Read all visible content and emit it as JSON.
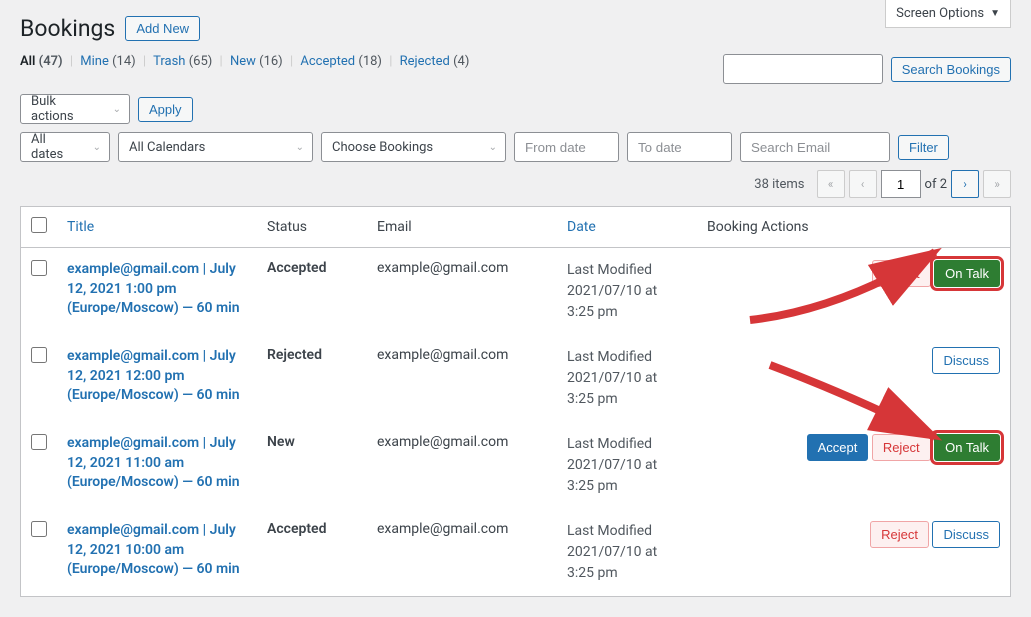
{
  "screen_options": "Screen Options",
  "page_title": "Bookings",
  "add_new": "Add New",
  "filters": {
    "all": {
      "label": "All",
      "count": "(47)"
    },
    "mine": {
      "label": "Mine",
      "count": "(14)"
    },
    "trash": {
      "label": "Trash",
      "count": "(65)"
    },
    "new": {
      "label": "New",
      "count": "(16)"
    },
    "accepted": {
      "label": "Accepted",
      "count": "(18)"
    },
    "rejected": {
      "label": "Rejected",
      "count": "(4)"
    }
  },
  "search": {
    "placeholder": "",
    "button": "Search Bookings"
  },
  "bulk": {
    "label": "Bulk actions",
    "apply": "Apply"
  },
  "row2": {
    "dates": "All dates",
    "calendars": "All Calendars",
    "bookings": "Choose Bookings",
    "from": "From date",
    "to": "To date",
    "email": "Search Email",
    "filter": "Filter"
  },
  "pagination": {
    "items": "38 items",
    "page": "1",
    "of": "of 2"
  },
  "columns": {
    "title": "Title",
    "status": "Status",
    "email": "Email",
    "date": "Date",
    "actions": "Booking Actions"
  },
  "action_labels": {
    "reject": "Reject",
    "accept": "Accept",
    "ontalk": "On Talk",
    "discuss": "Discuss"
  },
  "rows": [
    {
      "title": "example@gmail.com | July 12, 2021 1:00 pm (Europe/Moscow) — 60 min",
      "status": "Accepted",
      "email": "example@gmail.com",
      "date": "Last Modified\n2021/07/10 at 3:25 pm",
      "actions": [
        "reject",
        "ontalk"
      ],
      "highlight": true
    },
    {
      "title": "example@gmail.com | July 12, 2021 12:00 pm (Europe/Moscow) — 60 min",
      "status": "Rejected",
      "email": "example@gmail.com",
      "date": "Last Modified\n2021/07/10 at 3:25 pm",
      "actions": [
        "discuss"
      ],
      "highlight": false
    },
    {
      "title": "example@gmail.com | July 12, 2021 11:00 am (Europe/Moscow) — 60 min",
      "status": "New",
      "email": "example@gmail.com",
      "date": "Last Modified\n2021/07/10 at 3:25 pm",
      "actions": [
        "accept",
        "reject",
        "ontalk"
      ],
      "highlight": true
    },
    {
      "title": "example@gmail.com | July 12, 2021 10:00 am (Europe/Moscow) — 60 min",
      "status": "Accepted",
      "email": "example@gmail.com",
      "date": "Last Modified\n2021/07/10 at 3:25 pm",
      "actions": [
        "reject",
        "discuss"
      ],
      "highlight": false
    }
  ]
}
